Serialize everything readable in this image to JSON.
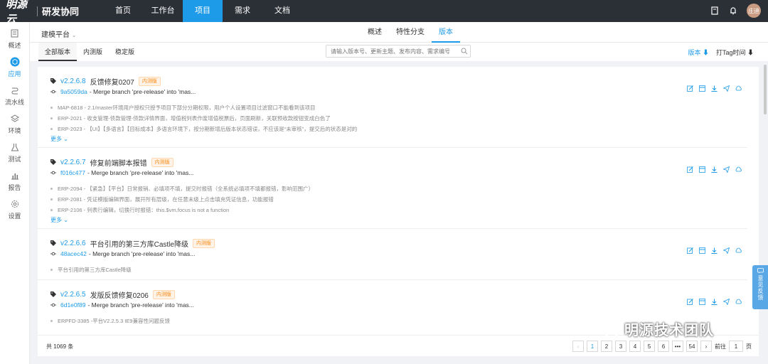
{
  "topbar": {
    "logo": "明源云",
    "app_title": "研发协同",
    "nav": [
      "首页",
      "工作台",
      "项目",
      "需求",
      "文档"
    ],
    "active_nav": 2,
    "avatar_text": "庄迪"
  },
  "sidebar": {
    "items": [
      {
        "label": "概述",
        "icon": "doc-icon"
      },
      {
        "label": "应用",
        "icon": "cube-icon"
      },
      {
        "label": "流水线",
        "icon": "pipeline-icon"
      },
      {
        "label": "环境",
        "icon": "layers-icon"
      },
      {
        "label": "测试",
        "icon": "flask-icon"
      },
      {
        "label": "报告",
        "icon": "bar-chart-icon"
      },
      {
        "label": "设置",
        "icon": "gear-icon"
      }
    ],
    "active": 1
  },
  "subheader": {
    "breadcrumb": "建模平台",
    "tabs": [
      "概述",
      "特性分支",
      "版本"
    ],
    "active_tab": 2
  },
  "toolbar": {
    "filter_tabs": [
      "全部版本",
      "内测版",
      "稳定版"
    ],
    "active_filter": 0,
    "search_placeholder": "请输入版本号、更新主题、发布内容、需求编号",
    "sort_version": "版本 ⬇",
    "sort_tag_time": "打Tag时间 ⬇"
  },
  "releases": [
    {
      "version": "v2.2.6.8",
      "title": "反馈修复0207",
      "badge": "内测版",
      "hash": "9a5059da",
      "commit": "- Merge branch 'pre-release' into 'mas...",
      "issues": [
        "MAP-6818 - 2.1/master环境用户授权只授予项目下部分分期权限，用户个人设置项目过滤窗口不能看到该项目",
        "ERP-2021 - 收支管理-债款管理-债款详情界面，增值税列表作废增值税票后，页面刷新，关联预收款按钮变成白色了",
        "ERP-2023 - 【UI】【多语言】【目标成本】多语言环境下，按分期新增后版本状态错误，不应该是“未审核”，提交后的状态是对的"
      ],
      "more": "更多"
    },
    {
      "version": "v2.2.6.7",
      "title": "修复前端脚本报错",
      "badge": "内测版",
      "hash": "f016c477",
      "commit": "- Merge branch 'pre-release' into 'mas...",
      "issues": [
        "ERP-2094 - 【紧急】【平台】日常报销、必填项不填，提交时报错（全系统必填项不填都报错，影响范围广）",
        "ERP-2081 - 凭证模版编辑界面，展开所有层级，在任意末级上点击填充凭证信息，功能报错",
        "ERP-2106 - 列表行编辑，切换行时报错：this.$vm.focus is not a function"
      ],
      "more": "更多"
    },
    {
      "version": "v2.2.6.6",
      "title": "平台引用的第三方库Castle降级",
      "badge": "内测版",
      "hash": "48acec42",
      "commit": "- Merge branch 'pre-release' into 'mas...",
      "issues": [
        "平台引用的第三方库Castle降级"
      ],
      "more": ""
    },
    {
      "version": "v2.2.6.5",
      "title": "发版反馈修复0206",
      "badge": "内测版",
      "hash": "6d1e0f89",
      "commit": "- Merge branch 'pre-release' into 'mas...",
      "issues": [
        "ERPFD-3385 -平台V2.2.5.3 IE9兼容性问题反馈"
      ],
      "more": ""
    }
  ],
  "footer": {
    "total": "共 1069 条",
    "pages": [
      "1",
      "2",
      "3",
      "4",
      "5",
      "6",
      "•••",
      "54"
    ],
    "active_page": 0,
    "goto_label": "前往",
    "goto_value": "1",
    "page_unit": "页"
  },
  "feedback_label": "意见反馈",
  "watermark": "明源技术团队",
  "colors": {
    "accent": "#1e9be8",
    "topbar": "#2b2f36",
    "badge": "#fa8c16"
  }
}
